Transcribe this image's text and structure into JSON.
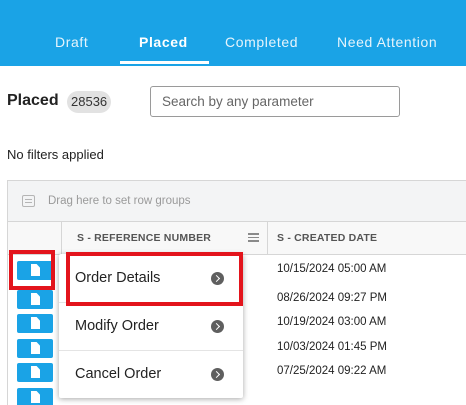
{
  "nav": {
    "tabs": [
      {
        "label": "Draft"
      },
      {
        "label": "Placed"
      },
      {
        "label": "Completed"
      },
      {
        "label": "Need Attention"
      }
    ],
    "active_tab": "Placed"
  },
  "page": {
    "title": "Placed",
    "count": "28536",
    "search_placeholder": "Search by any parameter",
    "filters_text": "No filters applied"
  },
  "grid": {
    "group_bar_text": "Drag here to set row groups",
    "columns": [
      "S - REFERENCE NUMBER",
      "S - CREATED DATE"
    ],
    "rows": [
      {
        "created": "10/15/2024 05:00 AM"
      },
      {
        "created": "08/26/2024 09:27 PM"
      },
      {
        "created": "10/19/2024 03:00 AM"
      },
      {
        "created": "10/03/2024 01:45 PM"
      },
      {
        "created": "07/25/2024 09:22 AM"
      },
      {
        "created": ""
      }
    ]
  },
  "context_menu": {
    "items": [
      {
        "label": "Order Details"
      },
      {
        "label": "Modify Order"
      },
      {
        "label": "Cancel Order"
      }
    ]
  },
  "colors": {
    "accent": "#1aa3e6",
    "highlight": "#e3141c"
  },
  "icons": {
    "row_action": "document-icon",
    "menu_item": "chevron-circle-right-icon",
    "group_bar": "row-groups-icon",
    "column_menu": "column-menu-icon"
  }
}
